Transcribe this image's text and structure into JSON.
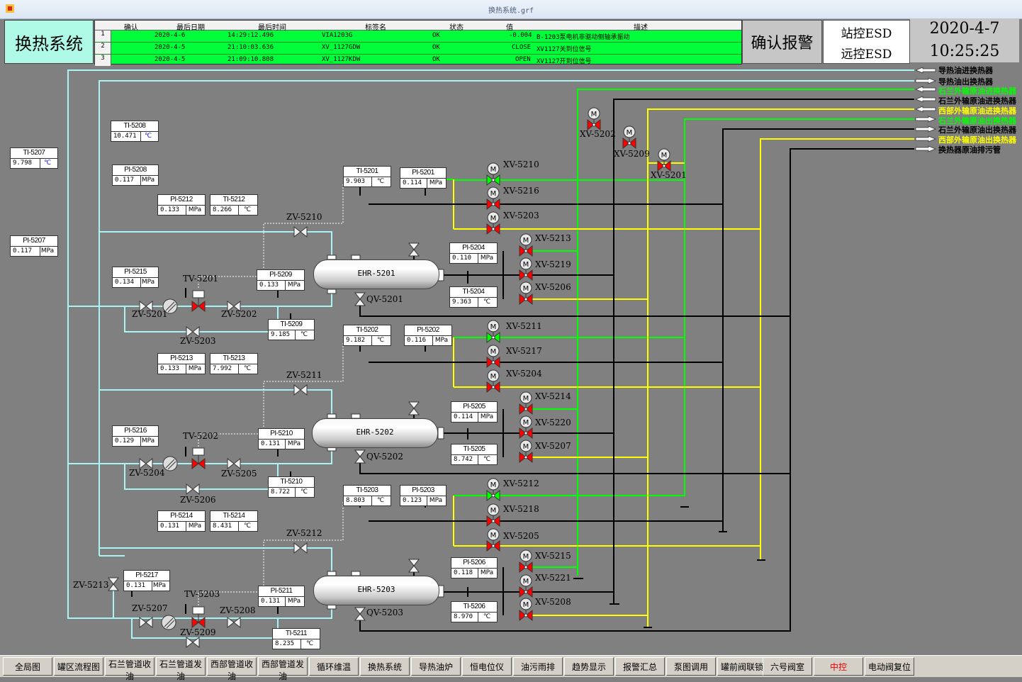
{
  "window_title": "换热系统.grf",
  "screen_title": "换热系统",
  "alarm_table": {
    "headers": [
      "确认",
      "最后日期",
      "最后时间",
      "标签名",
      "状态",
      "值",
      "描述"
    ],
    "rows": [
      {
        "idx": "1",
        "date": "2020-4-6",
        "time": "14:29:12.496",
        "tag": "VIA1203G",
        "status": "OK",
        "value": "-0.004",
        "desc": "B-1203泵电机非驱动侧轴承振动"
      },
      {
        "idx": "2",
        "date": "2020-4-5",
        "time": "21:10:03.636",
        "tag": "XV_1127GDW",
        "status": "OK",
        "value": "CLOSE",
        "desc": "XV1127关到位信号"
      },
      {
        "idx": "3",
        "date": "2020-4-5",
        "time": "21:09:10.808",
        "tag": "XV_1127KDW",
        "status": "OK",
        "value": "OPEN",
        "desc": "XV1127开到位信号"
      }
    ]
  },
  "ack_button": "确认报警",
  "esd": {
    "station": "站控ESD",
    "remote": "远控ESD"
  },
  "datetime": {
    "date": "2020-4-7",
    "time": "10:25:25"
  },
  "colors": {
    "cyan": "#a8f4f4",
    "green": "#00ff00",
    "yellow": "#ffff00",
    "black": "#000000",
    "valve_red": "#ff0000"
  },
  "instruments": [
    {
      "id": "ti5208",
      "tag": "TI-5208",
      "value": "10.471",
      "unit": "℃",
      "unit_color": "#0000ff"
    },
    {
      "id": "ti5207",
      "tag": "TI-5207",
      "value": "9.798",
      "unit": "℃",
      "unit_color": "#0000ff"
    },
    {
      "id": "pi5208",
      "tag": "PI-5208",
      "value": "0.117",
      "unit": "MPa"
    },
    {
      "id": "pi5212",
      "tag": "PI-5212",
      "value": "0.133",
      "unit": "MPa"
    },
    {
      "id": "ti5212",
      "tag": "TI-5212",
      "value": "8.266",
      "unit": "℃"
    },
    {
      "id": "pi5207",
      "tag": "PI-5207",
      "value": "0.117",
      "unit": "MPa"
    },
    {
      "id": "ti5201",
      "tag": "TI-5201",
      "value": "9.903",
      "unit": "℃"
    },
    {
      "id": "pi5201",
      "tag": "PI-5201",
      "value": "0.114",
      "unit": "MPa"
    },
    {
      "id": "pi5215",
      "tag": "PI-5215",
      "value": "0.134",
      "unit": "MPa"
    },
    {
      "id": "pi5209",
      "tag": "PI-5209",
      "value": "0.133",
      "unit": "MPa"
    },
    {
      "id": "pi5204",
      "tag": "PI-5204",
      "value": "0.110",
      "unit": "MPa"
    },
    {
      "id": "ti5204",
      "tag": "TI-5204",
      "value": "9.363",
      "unit": "℃"
    },
    {
      "id": "ti5209",
      "tag": "TI-5209",
      "value": "9.185",
      "unit": "℃"
    },
    {
      "id": "ti5202",
      "tag": "TI-5202",
      "value": "9.182",
      "unit": "℃"
    },
    {
      "id": "pi5202",
      "tag": "PI-5202",
      "value": "0.116",
      "unit": "MPa"
    },
    {
      "id": "pi5213",
      "tag": "PI-5213",
      "value": "0.133",
      "unit": "MPa"
    },
    {
      "id": "ti5213",
      "tag": "TI-5213",
      "value": "7.992",
      "unit": "℃"
    },
    {
      "id": "pi5205",
      "tag": "PI-5205",
      "value": "0.114",
      "unit": "MPa"
    },
    {
      "id": "pi5216",
      "tag": "PI-5216",
      "value": "0.129",
      "unit": "MPa"
    },
    {
      "id": "pi5210",
      "tag": "PI-5210",
      "value": "0.131",
      "unit": "MPa"
    },
    {
      "id": "ti5205",
      "tag": "TI-5205",
      "value": "8.742",
      "unit": "℃"
    },
    {
      "id": "ti5210",
      "tag": "TI-5210",
      "value": "8.722",
      "unit": "℃"
    },
    {
      "id": "ti5203",
      "tag": "TI-5203",
      "value": "8.803",
      "unit": "℃"
    },
    {
      "id": "pi5203",
      "tag": "PI-5203",
      "value": "0.123",
      "unit": "MPa"
    },
    {
      "id": "pi5214",
      "tag": "PI-5214",
      "value": "0.131",
      "unit": "MPa"
    },
    {
      "id": "ti5214",
      "tag": "TI-5214",
      "value": "8.431",
      "unit": "℃"
    },
    {
      "id": "pi5217",
      "tag": "PI-5217",
      "value": "0.131",
      "unit": "MPa"
    },
    {
      "id": "pi5206",
      "tag": "PI-5206",
      "value": "0.118",
      "unit": "MPa"
    },
    {
      "id": "pi5211",
      "tag": "PI-5211",
      "value": "0.131",
      "unit": "MPa"
    },
    {
      "id": "ti5206",
      "tag": "TI-5206",
      "value": "8.970",
      "unit": "℃"
    },
    {
      "id": "ti5211",
      "tag": "TI-5211",
      "value": "8.235",
      "unit": "℃"
    }
  ],
  "exchangers": [
    "EHR-5201",
    "EHR-5202",
    "EHR-5203"
  ],
  "valve_labels": {
    "xv5202": "XV-5202",
    "xv5209": "XV-5209",
    "xv5201": "XV-5201",
    "xv5210": "XV-5210",
    "xv5216": "XV-5216",
    "xv5203": "XV-5203",
    "xv5213": "XV-5213",
    "xv5219": "XV-5219",
    "xv5206": "XV-5206",
    "xv5211": "XV-5211",
    "xv5217": "XV-5217",
    "xv5204": "XV-5204",
    "xv5214": "XV-5214",
    "xv5220": "XV-5220",
    "xv5207": "XV-5207",
    "xv5212": "XV-5212",
    "xv5218": "XV-5218",
    "xv5205": "XV-5205",
    "xv5215": "XV-5215",
    "xv5221": "XV-5221",
    "xv5208": "XV-5208",
    "zv5210": "ZV-5210",
    "zv5211": "ZV-5211",
    "zv5212": "ZV-5212",
    "zv5201": "ZV-5201",
    "zv5202": "ZV-5202",
    "zv5203": "ZV-5203",
    "zv5204": "ZV-5204",
    "zv5205": "ZV-5205",
    "zv5206": "ZV-5206",
    "zv5207": "ZV-5207",
    "zv5208": "ZV-5208",
    "zv5209": "ZV-5209",
    "zv5213": "ZV-5213",
    "tv5201": "TV-5201",
    "tv5202": "TV-5202",
    "tv5203": "TV-5203",
    "qv5201": "QV-5201",
    "qv5202": "QV-5202",
    "qv5203": "QV-5203"
  },
  "motor_symbol": "M",
  "routes": {
    "r1": "导热油进换热器",
    "r2": "导热油出换热器",
    "r3": "石兰外输原油进换热器",
    "r4": "石兰外输原油进换热器",
    "r5": "西部外输原油进换热器",
    "r6": "石兰外输原油出换热器",
    "r7": "石兰外输原油出换热器",
    "r8": "西部外输原油出换热器",
    "r9": "换热器原油排污管"
  },
  "nav": [
    {
      "label": "全局图"
    },
    {
      "label": "罐区流程图"
    },
    {
      "label": "石兰管道收油"
    },
    {
      "label": "石兰管道发油"
    },
    {
      "label": "西部管道收油"
    },
    {
      "label": "西部管道发油"
    },
    {
      "label": "循环维温"
    },
    {
      "label": "换热系统"
    },
    {
      "label": "导热油炉"
    },
    {
      "label": "恒电位仪"
    },
    {
      "label": "油污雨排"
    },
    {
      "label": "趋势显示"
    },
    {
      "label": "报警汇总"
    },
    {
      "label": "泵图调用"
    },
    {
      "label": "罐前阀联锁"
    },
    {
      "label": "六号阀室"
    },
    {
      "label": "中控",
      "color": "#ee0000"
    },
    {
      "label": "电动阀复位"
    }
  ]
}
